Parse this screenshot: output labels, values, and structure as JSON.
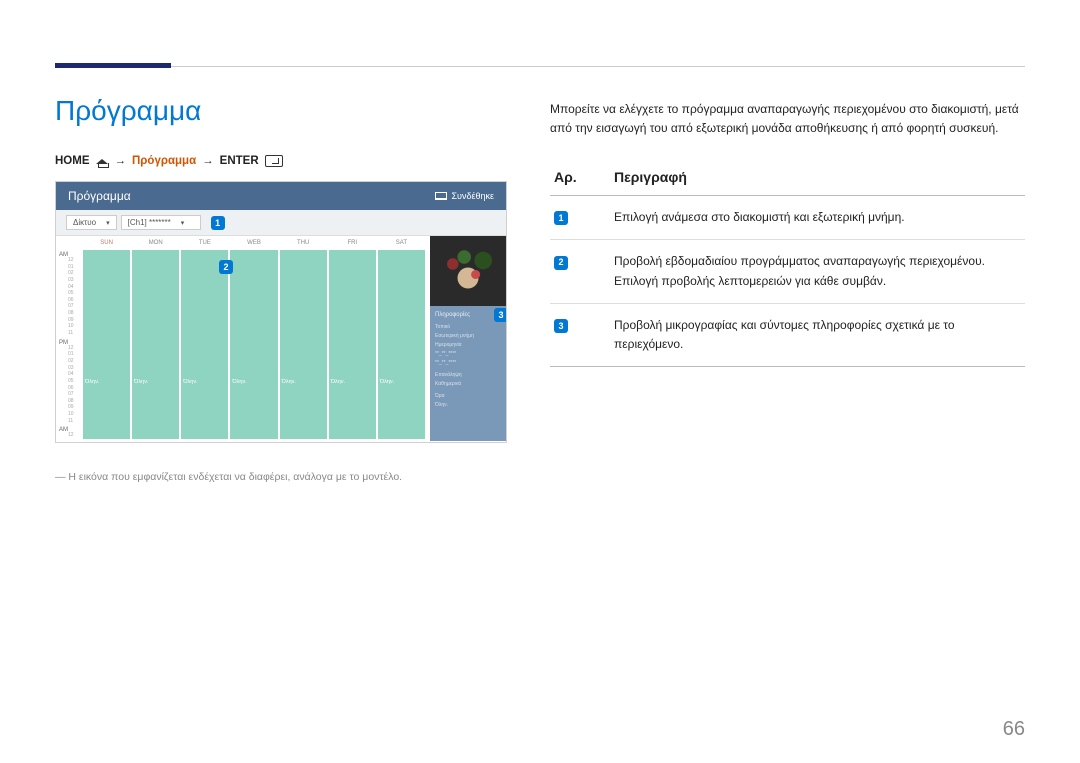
{
  "page_title": "Πρόγραμμα",
  "breadcrumb": {
    "home": "HOME",
    "mid": "Πρόγραμμα",
    "enter": "ENTER"
  },
  "mock": {
    "header_title": "Πρόγραμμα",
    "header_right": "Συνδέθηκε",
    "toolbar": {
      "sel1": "Δίκτυο",
      "sel2": "[Ch1] *******"
    },
    "days": [
      "SUN",
      "MON",
      "TUE",
      "WEB",
      "THU",
      "FRI",
      "SAT"
    ],
    "ampm": [
      "AM",
      "PM",
      "AM"
    ],
    "hours_top": [
      "12",
      "01",
      "02",
      "03",
      "04",
      "05",
      "06",
      "07",
      "08",
      "09",
      "10",
      "11"
    ],
    "hours_bot": [
      "12",
      "01",
      "02",
      "03",
      "04",
      "05",
      "06",
      "07",
      "08",
      "09",
      "10",
      "11",
      "12"
    ],
    "event_label": "Όλην.",
    "info": {
      "header": "Πληροφορίες",
      "r1": "Τοπικό",
      "r2": "Εσωτερική μνήμη",
      "r3": "Ημερομηνία",
      "r4": "**_**_****",
      "r5": "**_**_****",
      "r6": "Επανάληψη",
      "r7": "Καθημερινά",
      "r8": "Ώρα",
      "r9": "Όλην."
    }
  },
  "callouts": {
    "c1": "1",
    "c2": "2",
    "c3": "3"
  },
  "note": "― Η εικόνα που εμφανίζεται ενδέχεται να διαφέρει, ανάλογα με το μοντέλο.",
  "intro": "Μπορείτε να ελέγχετε το πρόγραμμα αναπαραγωγής περιεχομένου στο διακομιστή, μετά από την εισαγωγή του από εξωτερική μονάδα αποθήκευσης ή από φορητή συσκευή.",
  "table": {
    "head_no": "Αρ.",
    "head_desc": "Περιγραφή",
    "rows": [
      {
        "n": "1",
        "d": "Επιλογή ανάμεσα στο διακομιστή και εξωτερική μνήμη."
      },
      {
        "n": "2",
        "d": "Προβολή εβδομαδιαίου προγράμματος αναπαραγωγής περιεχομένου.\nΕπιλογή προβολής λεπτομερειών για κάθε συμβάν."
      },
      {
        "n": "3",
        "d": "Προβολή μικρογραφίας και σύντομες πληροφορίες σχετικά με το περιεχόμενο."
      }
    ]
  },
  "page_number": "66"
}
